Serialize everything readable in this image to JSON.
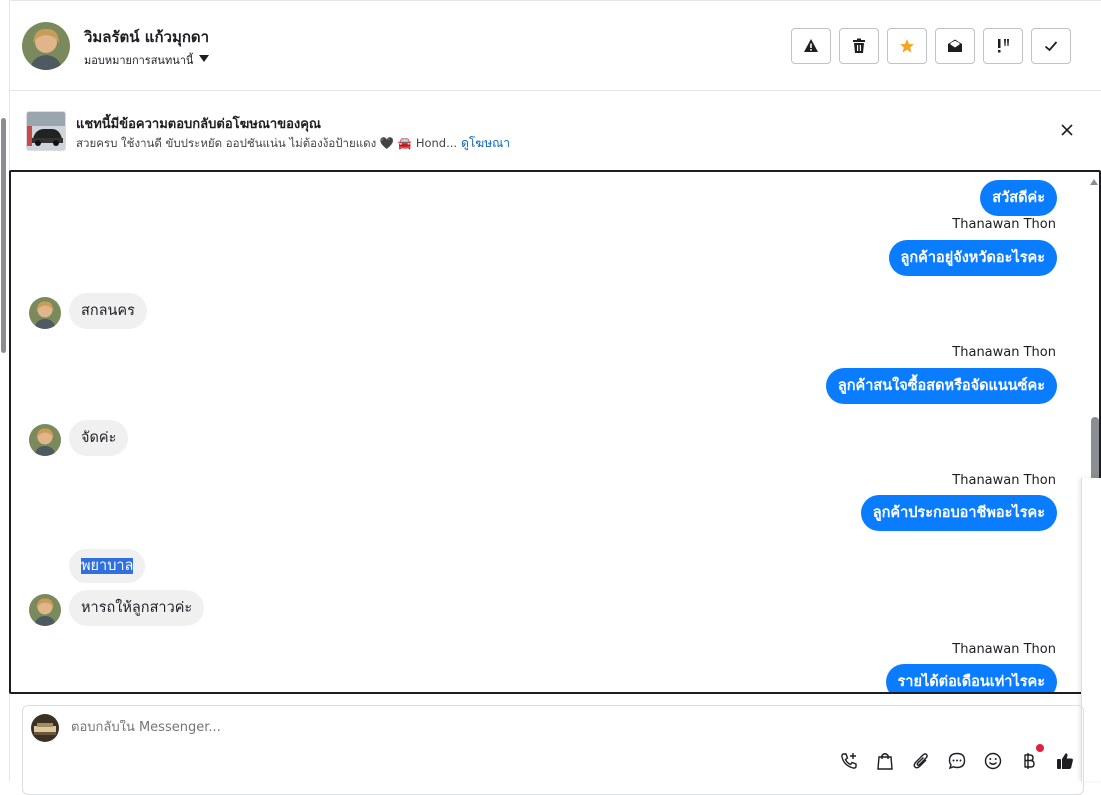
{
  "header": {
    "contact_name": "วิมลรัตน์ แก้วมุกดา",
    "assign_label": "มอบหมายการสนทนานี้",
    "actions": [
      {
        "name": "spam-icon",
        "label": "warning"
      },
      {
        "name": "trash-icon",
        "label": "delete"
      },
      {
        "name": "star-icon",
        "label": "star"
      },
      {
        "name": "mark-unread-icon",
        "label": "unread"
      },
      {
        "name": "follow-up-icon",
        "label": "follow up"
      },
      {
        "name": "done-icon",
        "label": "done"
      }
    ],
    "star_color": "#f5a623"
  },
  "ad": {
    "title": "แชทนี้มีข้อความตอบกลับต่อโฆษณาของคุณ",
    "subtitle": "สวยครบ ใช้งานดี ขับประหยัด ออปชันแน่น ไม่ต้องง้อป้ายแดง 🖤 🚘 Hond...",
    "link": "ดูโฆษณา"
  },
  "messages": [
    {
      "dir": "out",
      "text": "สวัสดีค่ะ"
    },
    {
      "dir": "out",
      "sender": "Thanawan Thon",
      "text": "ลูกค้าอยู่จังหวัดอะไรคะ"
    },
    {
      "dir": "in",
      "text": "สกลนคร"
    },
    {
      "dir": "out",
      "sender": "Thanawan Thon",
      "text": "ลูกค้าสนใจซื้อสดหรือจัดแนนซ์คะ"
    },
    {
      "dir": "in",
      "text": "จัดค่ะ"
    },
    {
      "dir": "out",
      "sender": "Thanawan Thon",
      "text": "ลูกค้าประกอบอาชีพอะไรคะ"
    },
    {
      "dir": "in",
      "text": "พยาบาล",
      "highlighted": true
    },
    {
      "dir": "in",
      "text": "หารถให้ลูกสาวค่ะ"
    },
    {
      "dir": "out",
      "sender": "Thanawan Thon",
      "text": "รายได้ต่อเดือนเท่าไรคะ"
    }
  ],
  "reply": {
    "placeholder": "ตอบกลับใน Messenger..."
  },
  "colors": {
    "accent": "#0a7cff",
    "link": "#0a66c2",
    "highlight": "#2f6fde",
    "badge": "#e41e3f"
  }
}
